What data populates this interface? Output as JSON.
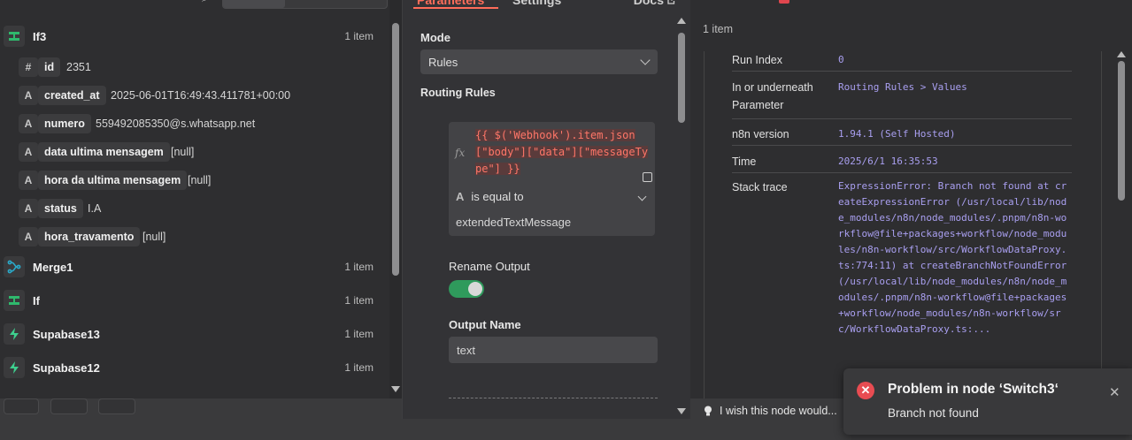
{
  "left_panel": {
    "nodes": [
      {
        "name": "If3",
        "count": "1 item",
        "icon": "if-icon",
        "icon_color": "#2fb96d"
      },
      {
        "name": "Merge1",
        "count": "1 item",
        "icon": "merge-icon",
        "icon_color": "#2aa9c9"
      },
      {
        "name": "If",
        "count": "1 item",
        "icon": "if-icon",
        "icon_color": "#2fb96d"
      },
      {
        "name": "Supabase13",
        "count": "1 item",
        "icon": "supabase-icon",
        "icon_color": "#3ecf8e"
      },
      {
        "name": "Supabase12",
        "count": "1 item",
        "icon": "supabase-icon",
        "icon_color": "#3ecf8e"
      }
    ],
    "fields": [
      {
        "type": "#",
        "key": "id",
        "value": "2351"
      },
      {
        "type": "A",
        "key": "created_at",
        "value": "2025-06-01T16:49:43.411781+00:00"
      },
      {
        "type": "A",
        "key": "numero",
        "value": "559492085350@s.whatsapp.net"
      },
      {
        "type": "A",
        "key": "data ultima mensagem",
        "value": "[null]"
      },
      {
        "type": "A",
        "key": "hora da ultima mensagem",
        "value": "[null]"
      },
      {
        "type": "A",
        "key": "status",
        "value": "I.A"
      },
      {
        "type": "A",
        "key": "hora_travamento",
        "value": "[null]"
      }
    ]
  },
  "center_panel": {
    "tabs": {
      "parameters": "Parameters",
      "settings": "Settings",
      "docs": "Docs"
    },
    "mode_label": "Mode",
    "mode_value": "Rules",
    "routing_rules_label": "Routing Rules",
    "fx": "fx",
    "expression_lines": [
      "{{ $('Webhook').item.json",
      "[\"body\"][\"data\"][\"messageTy",
      "pe\"] }}"
    ],
    "condition_type_icon": "A",
    "condition_type": "is equal to",
    "condition_value": "extendedTextMessage",
    "rename_output_label": "Rename Output",
    "rename_output_on": true,
    "output_name_label": "Output Name",
    "output_name_value": "text"
  },
  "right_panel": {
    "item_count": "1 item",
    "details": [
      {
        "key": "Run Index",
        "value": "0"
      },
      {
        "key": "In or underneath Parameter",
        "value": "Routing Rules > Values"
      },
      {
        "key": "n8n version",
        "value": "1.94.1 (Self Hosted)"
      },
      {
        "key": "Time",
        "value": "2025/6/1 16:35:53"
      },
      {
        "key": "Stack trace",
        "value": "ExpressionError: Branch not found at createExpressionError (/usr/local/lib/node_modules/n8n/node_modules/.pnpm/n8n-workflow@file+packages+workflow/node_modules/n8n-workflow/src/WorkflowDataProxy.ts:774:11) at createBranchNotFoundError (/usr/local/lib/node_modules/n8n/node_modules/.pnpm/n8n-workflow@file+packages+workflow/node_modules/n8n-workflow/src/WorkflowDataProxy.ts:..."
      }
    ],
    "feedback_text": "I wish this node would..."
  },
  "toast": {
    "title": "Problem in node ‘Switch3‘",
    "message": "Branch not found",
    "icon_color": "#e84c52"
  },
  "colors": {
    "accent": "#ff6d5a",
    "toggle_on": "#2f9a5c",
    "mono_value": "#a99ff0"
  }
}
